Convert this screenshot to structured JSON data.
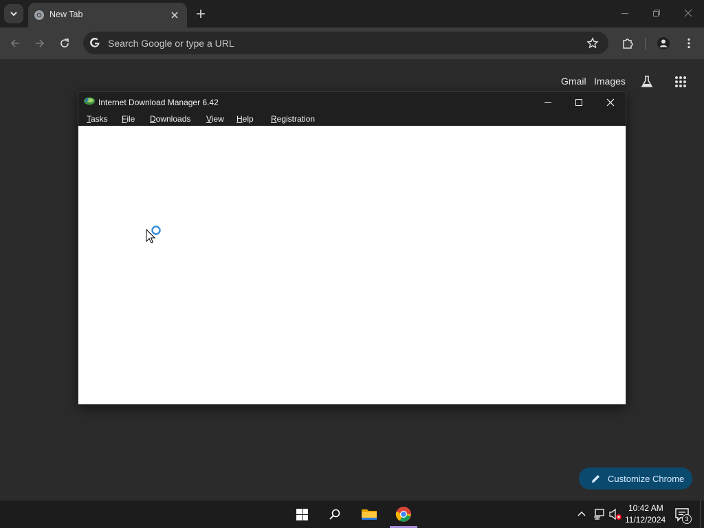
{
  "browser": {
    "tab": {
      "title": "New Tab",
      "favicon": "chrome-icon"
    },
    "omnibox": {
      "placeholder": "Search Google or type a URL"
    },
    "ntp": {
      "gmail": "Gmail",
      "images": "Images",
      "customize": "Customize Chrome"
    }
  },
  "idm": {
    "title": "Internet Download Manager 6.42",
    "menu": [
      {
        "label": "Tasks",
        "ul": "T",
        "rest": "asks"
      },
      {
        "label": "File",
        "ul": "F",
        "rest": "ile"
      },
      {
        "label": "Downloads",
        "ul": "D",
        "rest": "ownloads"
      },
      {
        "label": "View",
        "ul": "V",
        "rest": "iew"
      },
      {
        "label": "Help",
        "ul": "H",
        "rest": "elp"
      },
      {
        "label": "Registration",
        "ul": "R",
        "rest": "egistration"
      }
    ]
  },
  "taskbar": {
    "time": "10:42 AM",
    "date": "11/12/2024",
    "notifications": "3"
  },
  "colors": {
    "accent": "#0b4a6f",
    "taskbar_indicator": "#a88bd8"
  }
}
